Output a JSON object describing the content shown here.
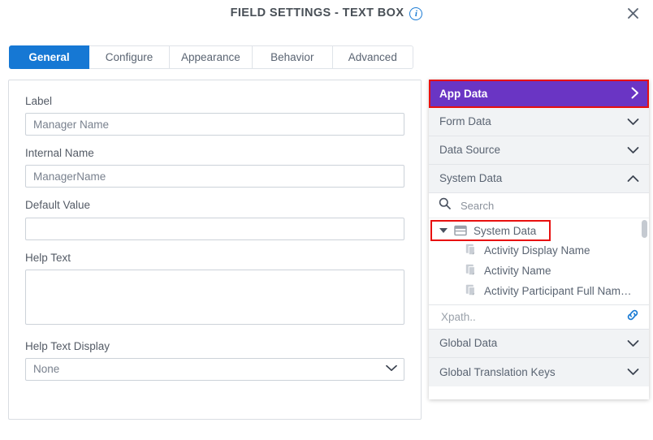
{
  "header": {
    "title": "FIELD SETTINGS - TEXT BOX",
    "info_icon": "info-icon",
    "close_icon": "close-icon"
  },
  "tabs": [
    {
      "label": "General",
      "active": true
    },
    {
      "label": "Configure",
      "active": false
    },
    {
      "label": "Appearance",
      "active": false
    },
    {
      "label": "Behavior",
      "active": false
    },
    {
      "label": "Advanced",
      "active": false
    }
  ],
  "form": {
    "label_field": {
      "label": "Label",
      "value": "Manager Name"
    },
    "internal_name": {
      "label": "Internal Name",
      "value": "ManagerName"
    },
    "default_value": {
      "label": "Default Value",
      "value": ""
    },
    "help_text": {
      "label": "Help Text",
      "value": ""
    },
    "help_text_display": {
      "label": "Help Text Display",
      "value": "None"
    }
  },
  "data_panel": {
    "sections": [
      {
        "label": "App Data",
        "chevron": "chevron-right-icon",
        "highlighted": true
      },
      {
        "label": "Form Data",
        "chevron": "chevron-down-icon",
        "highlighted": false
      },
      {
        "label": "Data Source",
        "chevron": "chevron-down-icon",
        "highlighted": false
      },
      {
        "label": "System Data",
        "chevron": "chevron-up-icon",
        "highlighted": false
      }
    ],
    "search": {
      "placeholder": "Search",
      "value": "",
      "icon": "search-icon"
    },
    "tree": {
      "root": {
        "label": "System Data",
        "icon": "table-icon",
        "expanded": true,
        "highlighted": true
      },
      "children": [
        {
          "label": "Activity Display Name",
          "icon": "document-icon"
        },
        {
          "label": "Activity Name",
          "icon": "document-icon"
        },
        {
          "label": "Activity Participant Full Nam…",
          "icon": "document-icon"
        }
      ]
    },
    "xpath": {
      "placeholder": "Xpath..",
      "value": "",
      "icon": "link-icon"
    },
    "footer_sections": [
      {
        "label": "Global Data",
        "chevron": "chevron-down-icon"
      },
      {
        "label": "Global Translation Keys",
        "chevron": "chevron-down-icon"
      }
    ]
  },
  "colors": {
    "accent_blue": "#1678d4",
    "accent_purple": "#6a35c4",
    "highlight_red": "#e8100f",
    "link_blue": "#1a7bd4"
  }
}
